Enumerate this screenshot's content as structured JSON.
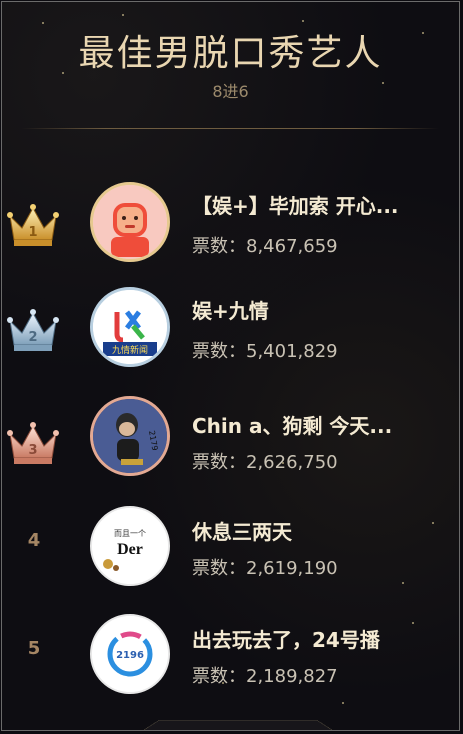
{
  "header": {
    "title": "最佳男脱口秀艺人",
    "subtitle": "8进6"
  },
  "colors": {
    "gold": "#e9d6b1",
    "silver": "#b8cfe0",
    "bronze": "#e3a993",
    "background": "#0e0d12"
  },
  "entries": [
    {
      "rank": "1",
      "name": "【娱+】毕加索 开心...",
      "votes_label": "票数：8,467,659",
      "badge": "gold-crown"
    },
    {
      "rank": "2",
      "name": "娱+九情",
      "votes_label": "票数：5,401,829",
      "badge": "silver-crown"
    },
    {
      "rank": "3",
      "name": "Chin a、狗剩 今天...",
      "votes_label": "票数：2,626,750",
      "badge": "bronze-crown"
    },
    {
      "rank": "4",
      "name": "休息三两天",
      "votes_label": "票数：2,619,190",
      "badge": ""
    },
    {
      "rank": "5",
      "name": "出去玩去了，24号播",
      "votes_label": "票数：2,189,827",
      "badge": ""
    }
  ],
  "avatars": [
    {
      "icon": "cartoon-face-avatar"
    },
    {
      "icon": "yule-jiuqing-logo-avatar",
      "text": "九情新闻"
    },
    {
      "icon": "character-avatar",
      "text": "2179"
    },
    {
      "icon": "text-avatar",
      "text_top": "而且一个",
      "text_main": "Der"
    },
    {
      "icon": "logo-avatar",
      "text": "2196"
    }
  ]
}
